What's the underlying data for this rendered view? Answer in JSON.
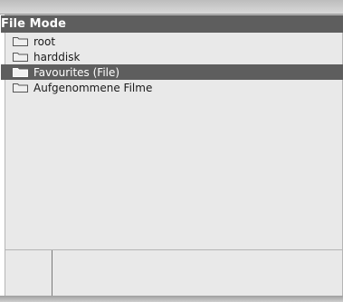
{
  "window": {
    "title": "File Mode"
  },
  "list": {
    "items": [
      {
        "label": "root",
        "icon": "folder-icon",
        "selected": false
      },
      {
        "label": "harddisk",
        "icon": "folder-icon",
        "selected": false
      },
      {
        "label": "Favourites (File)",
        "icon": "folder-icon",
        "selected": true
      },
      {
        "label": "Aufgenommene Filme",
        "icon": "folder-icon",
        "selected": false
      }
    ]
  },
  "colors": {
    "title_bg": "#5e5e5e",
    "selection_bg": "#5e5e5e",
    "panel_bg": "#e9e9e9"
  }
}
